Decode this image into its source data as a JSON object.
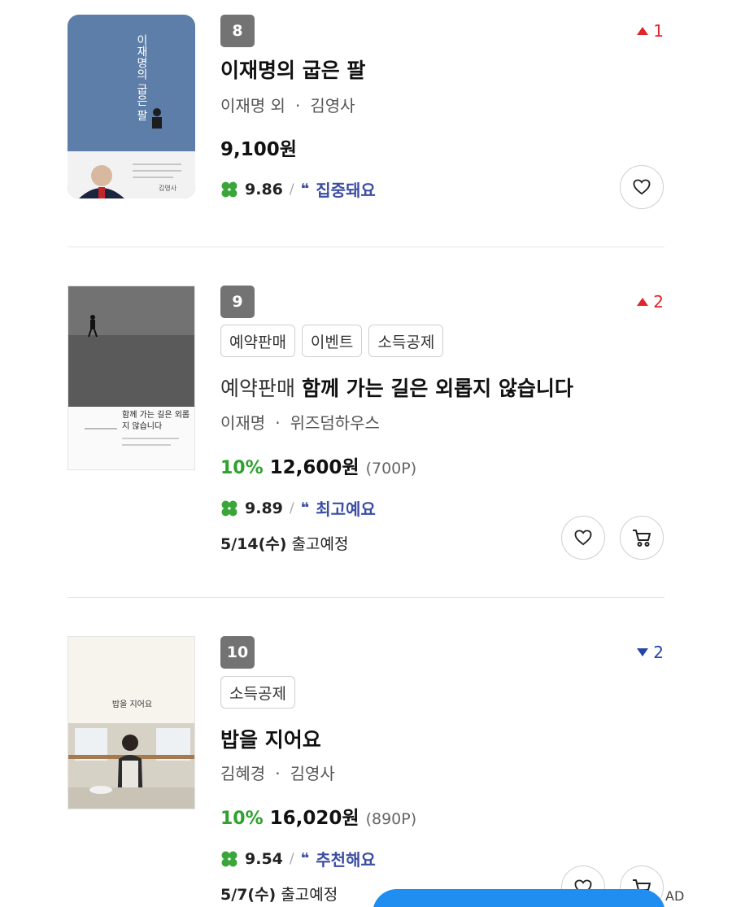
{
  "items": [
    {
      "rank": "8",
      "rank_change": "1",
      "rank_direction": "up",
      "tags": [],
      "title_prefix": "",
      "title": "이재명의 굽은 팔",
      "author": "이재명 외",
      "separator": "·",
      "publisher": "김영사",
      "discount": "",
      "price": "9,100원",
      "points": "",
      "score": "9.86",
      "review_label": "집중돼요",
      "ship_date": "",
      "ship_label": "",
      "cover_title": "이재명의 굽은 팔",
      "cover_publisher": "김영사",
      "buttons": [
        "heart-icon"
      ]
    },
    {
      "rank": "9",
      "rank_change": "2",
      "rank_direction": "up",
      "tags": [
        "예약판매",
        "이벤트",
        "소득공제"
      ],
      "title_prefix": "예약판매",
      "title": "함께 가는 길은 외롭지 않습니다",
      "author": "이재명",
      "separator": "·",
      "publisher": "위즈덤하우스",
      "discount": "10%",
      "price": "12,600원",
      "points": "(700P)",
      "score": "9.89",
      "review_label": "최고예요",
      "ship_date": "5/14(수)",
      "ship_label": "출고예정",
      "cover_title": "함께 가는 길은 외롭지 않습니다",
      "cover_publisher": "",
      "buttons": [
        "heart-icon",
        "cart-icon"
      ]
    },
    {
      "rank": "10",
      "rank_change": "2",
      "rank_direction": "down",
      "tags": [
        "소득공제"
      ],
      "title_prefix": "",
      "title": "밥을 지어요",
      "author": "김혜경",
      "separator": "·",
      "publisher": "김영사",
      "discount": "10%",
      "price": "16,020원",
      "points": "(890P)",
      "score": "9.54",
      "review_label": "추천해요",
      "ship_date": "5/7(수)",
      "ship_label": "출고예정",
      "cover_title": "밥을 지어요",
      "cover_publisher": "",
      "buttons": [
        "heart-icon",
        "cart-icon"
      ]
    }
  ],
  "ad_label": "AD",
  "colors": {
    "rank_up": "#e0262b",
    "rank_down": "#2445a8",
    "discount": "#2ea12e",
    "review": "#3b4ea2",
    "clover": "#3aa63a",
    "banner": "#1f8ef0"
  }
}
